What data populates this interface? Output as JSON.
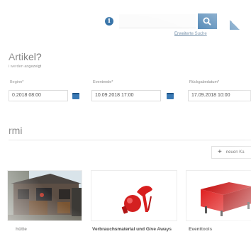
{
  "header": {
    "info_icon": "info-icon",
    "search_placeholder": "",
    "search_icon": "search-icon",
    "advanced_search": "Erweiterte Suche"
  },
  "question": {
    "title": "Artikel?",
    "subtitle": "i werden angezeigt"
  },
  "dates": [
    {
      "label": "Beginn*",
      "value": "0.2018 08:00",
      "icon": "calendar-icon"
    },
    {
      "label": "Eventende*",
      "value": "10.09.2018 17:00",
      "icon": "calendar-icon"
    },
    {
      "label": "Rückgabedatum*",
      "value": "17.09.2018 10:00",
      "icon": "calendar-icon"
    }
  ],
  "section": {
    "title": "rmi",
    "new_button": "neuen Ka"
  },
  "cards": [
    {
      "title": "hütte"
    },
    {
      "title": "Verbrauchsmaterial und Give Aways"
    },
    {
      "title": "Eventtools"
    }
  ],
  "colors": {
    "accent": "#2e6fa7",
    "text": "#444444",
    "red": "#d81e1e"
  }
}
